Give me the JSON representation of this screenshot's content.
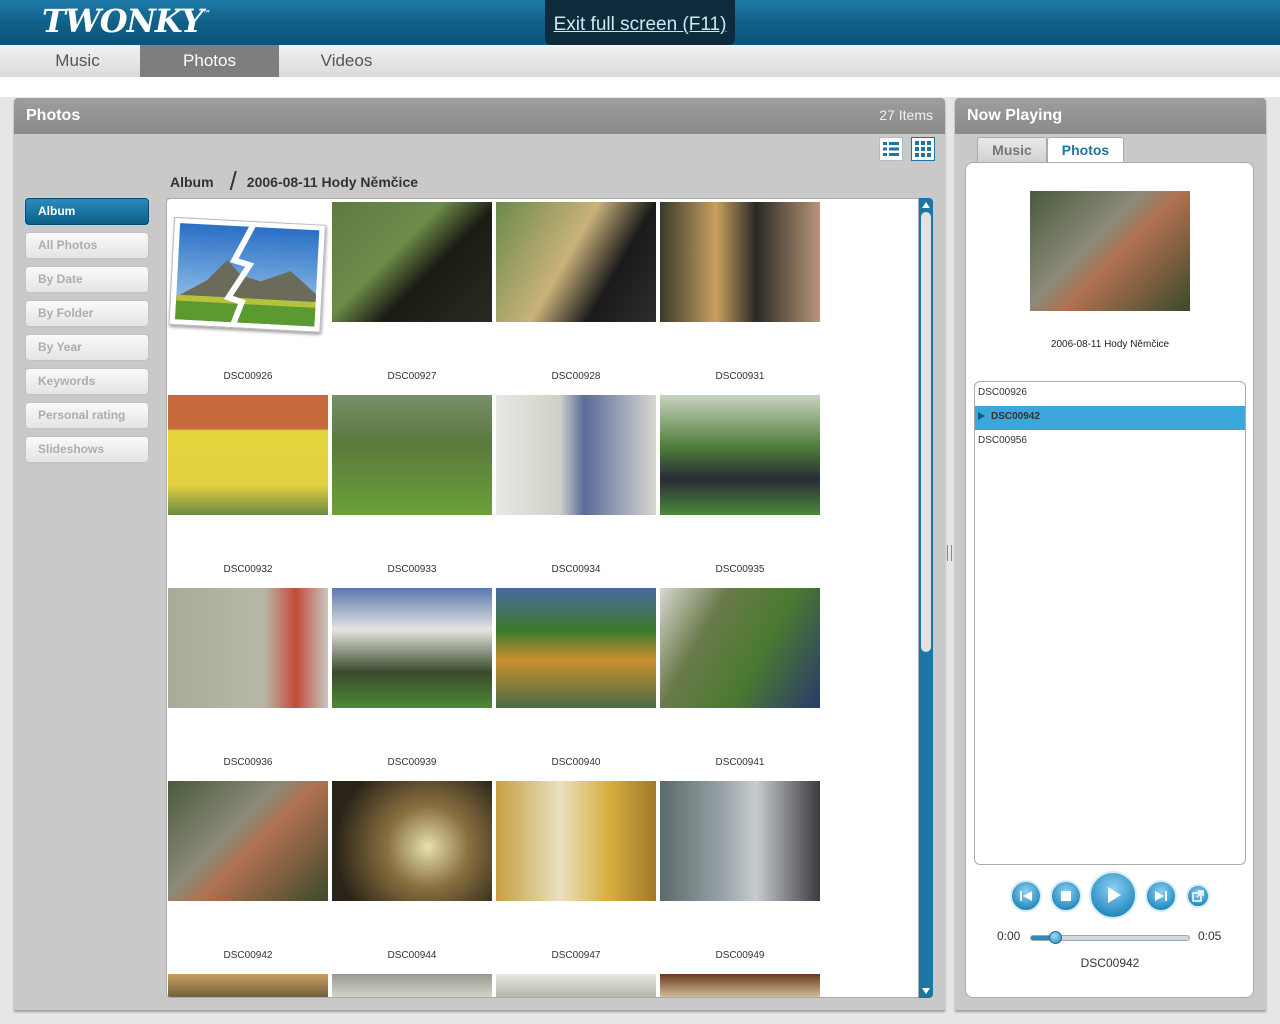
{
  "app": {
    "logo": "TWONKY",
    "logo_tm": "™",
    "exit_fullscreen": "Exit full screen (F11)"
  },
  "nav": {
    "tabs": [
      {
        "label": "Music"
      },
      {
        "label": "Photos",
        "active": true
      },
      {
        "label": "Videos"
      }
    ]
  },
  "photos_panel": {
    "title": "Photos",
    "item_count": "27 Items",
    "breadcrumb": {
      "root": "Album",
      "separator": "/",
      "current": "2006-08-11 Hody Němčice"
    },
    "view_buttons": [
      {
        "icon": "list-view-icon"
      },
      {
        "icon": "grid-view-icon",
        "active": true
      }
    ],
    "sidebar": [
      {
        "label": "Album",
        "active": true
      },
      {
        "label": "All Photos"
      },
      {
        "label": "By Date"
      },
      {
        "label": "By Folder"
      },
      {
        "label": "By Year"
      },
      {
        "label": "Keywords"
      },
      {
        "label": "Personal rating"
      },
      {
        "label": "Slideshows"
      }
    ],
    "thumbnails": [
      {
        "caption": "DSC00926",
        "broken": true
      },
      {
        "caption": "DSC00927"
      },
      {
        "caption": "DSC00928"
      },
      {
        "caption": "DSC00931"
      },
      {
        "caption": "DSC00932"
      },
      {
        "caption": "DSC00933"
      },
      {
        "caption": "DSC00934"
      },
      {
        "caption": "DSC00935"
      },
      {
        "caption": "DSC00936"
      },
      {
        "caption": "DSC00939"
      },
      {
        "caption": "DSC00940"
      },
      {
        "caption": "DSC00941"
      },
      {
        "caption": "DSC00942"
      },
      {
        "caption": "DSC00944"
      },
      {
        "caption": "DSC00947"
      },
      {
        "caption": "DSC00949"
      }
    ]
  },
  "now_playing": {
    "title": "Now Playing",
    "tabs": [
      {
        "label": "Music"
      },
      {
        "label": "Photos",
        "active": true
      }
    ],
    "album": "2006-08-11 Hody Němčice",
    "playlist": [
      {
        "label": "DSC00926"
      },
      {
        "label": "DSC00942",
        "selected": true
      },
      {
        "label": "DSC00956"
      }
    ],
    "controls": {
      "prev": "skip-back-icon",
      "stop": "stop-icon",
      "play": "play-icon",
      "next": "skip-forward-icon",
      "popout": "external-link-icon"
    },
    "time_current": "0:00",
    "time_total": "0:05",
    "progress": 0.15,
    "current_title": "DSC00942"
  },
  "colors": {
    "accent": "#1d7aa7",
    "header": "#0f5f86",
    "selection": "#3ca7dc"
  }
}
